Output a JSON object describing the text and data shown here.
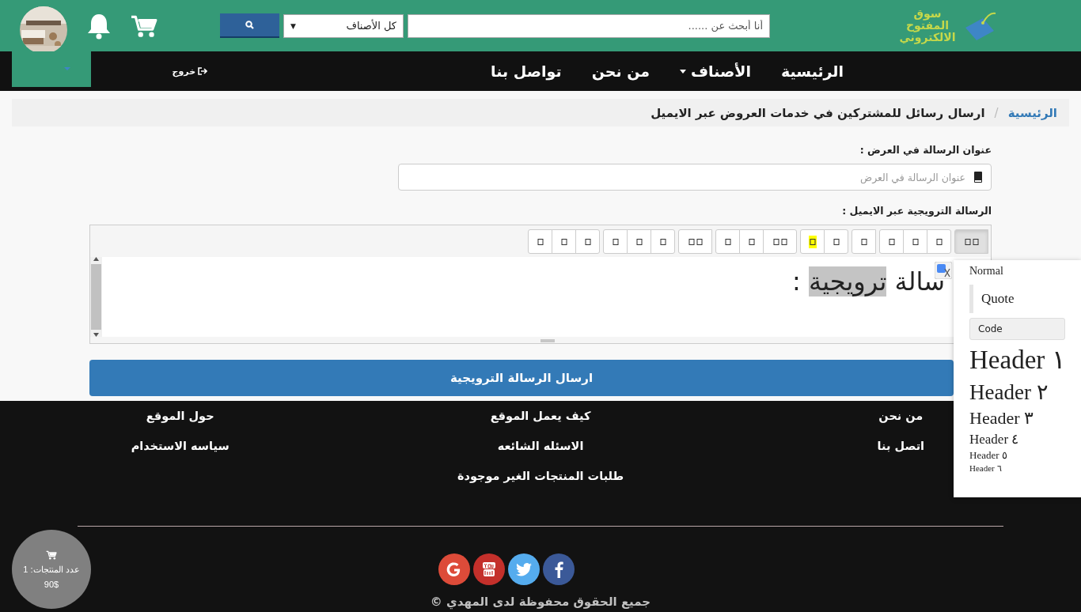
{
  "header": {
    "logo_text": "سوق المفتوح الالكتروني",
    "search": {
      "placeholder": "أنا أبحث عن ......"
    },
    "category": {
      "value": "كل الأصناف",
      "arrow": "▼"
    }
  },
  "nav": {
    "items": [
      {
        "label": "الرئيسية",
        "kind": "link"
      },
      {
        "label": "الأصناف",
        "kind": "dropdown"
      },
      {
        "label": "من نحن",
        "kind": "link"
      },
      {
        "label": "تواصل بنا",
        "kind": "link"
      }
    ],
    "logout": "خروج",
    "user_menu": {
      "expanded": true
    }
  },
  "breadcrumb": {
    "separator": "/",
    "items": [
      {
        "label": "الرئيسية",
        "kind": "link"
      },
      {
        "label": "ارسال رسائل للمشتركين في خدمات العروض عبر الايميل",
        "kind": "current"
      }
    ]
  },
  "form": {
    "title_label": "عنوان الرسالة في العرض :",
    "title_placeholder": "عنوان الرسالة في العرض",
    "message_label": "الرسالة الترويجية عبر الايميل :",
    "toolbar": [
      {
        "buttons": [
          {
            "kind": "wide",
            "selected": true,
            "highlighted": false
          }
        ]
      },
      {
        "buttons": [
          {
            "kind": "narrow",
            "selected": false,
            "highlighted": false
          },
          {
            "kind": "narrow",
            "selected": false,
            "highlighted": false
          },
          {
            "kind": "narrow",
            "selected": false,
            "highlighted": false
          }
        ]
      },
      {
        "buttons": [
          {
            "kind": "narrow",
            "selected": false,
            "highlighted": false
          }
        ]
      },
      {
        "buttons": [
          {
            "kind": "narrow",
            "selected": false,
            "highlighted": false
          },
          {
            "kind": "narrow",
            "selected": false,
            "highlighted": true
          }
        ]
      },
      {
        "buttons": [
          {
            "kind": "wide",
            "selected": false,
            "highlighted": false
          },
          {
            "kind": "narrow",
            "selected": false,
            "highlighted": false
          },
          {
            "kind": "narrow",
            "selected": false,
            "highlighted": false
          }
        ]
      },
      {
        "buttons": [
          {
            "kind": "wide",
            "selected": false,
            "highlighted": false
          }
        ]
      },
      {
        "buttons": [
          {
            "kind": "narrow",
            "selected": false,
            "highlighted": false
          },
          {
            "kind": "narrow",
            "selected": false,
            "highlighted": false
          },
          {
            "kind": "narrow",
            "selected": false,
            "highlighted": false
          }
        ]
      },
      {
        "buttons": [
          {
            "kind": "narrow",
            "selected": false,
            "highlighted": false
          },
          {
            "kind": "narrow",
            "selected": false,
            "highlighted": false
          },
          {
            "kind": "narrow",
            "selected": false,
            "highlighted": false
          }
        ]
      }
    ],
    "editor_content": [
      {
        "text": "سالة",
        "selected": false
      },
      {
        "text": "ترويجية",
        "selected": true
      },
      {
        "text": ":",
        "selected": false
      }
    ],
    "format_menu": [
      {
        "label": "Normal",
        "kind": "normal"
      },
      {
        "label": "Quote",
        "kind": "quote"
      },
      {
        "label": "Code",
        "kind": "code"
      },
      {
        "label": "Header ١",
        "kind": "h1"
      },
      {
        "label": "Header ٢",
        "kind": "h2"
      },
      {
        "label": "Header ٣",
        "kind": "h3"
      },
      {
        "label": "Header ٤",
        "kind": "h4"
      },
      {
        "label": "Header ٥",
        "kind": "h5"
      },
      {
        "label": "Header ٦",
        "kind": "h6"
      }
    ],
    "submit": "ارسال الرسالة الترويجية"
  },
  "footer": {
    "columns": [
      {
        "links": [
          "من نحن",
          "اتصل بنا"
        ]
      },
      {
        "links": [
          "كيف يعمل الموقع",
          "الاسئله الشائعه",
          "طلبات المنتجات الغير موجودة"
        ]
      },
      {
        "links": [
          "حول الموقع",
          "سياسه الاستخدام"
        ]
      }
    ],
    "social": [
      {
        "kind": "facebook",
        "color": "#3b5998"
      },
      {
        "kind": "twitter",
        "color": "#55acee"
      },
      {
        "kind": "youtube",
        "color": "#c4302b"
      },
      {
        "kind": "google",
        "color": "#dd4b39"
      }
    ],
    "copyright": "جميع الحقوق محفوظة لدى المهدي ©"
  },
  "cart_bubble": {
    "count": "عدد المنتجات: 1",
    "total": "90$"
  }
}
